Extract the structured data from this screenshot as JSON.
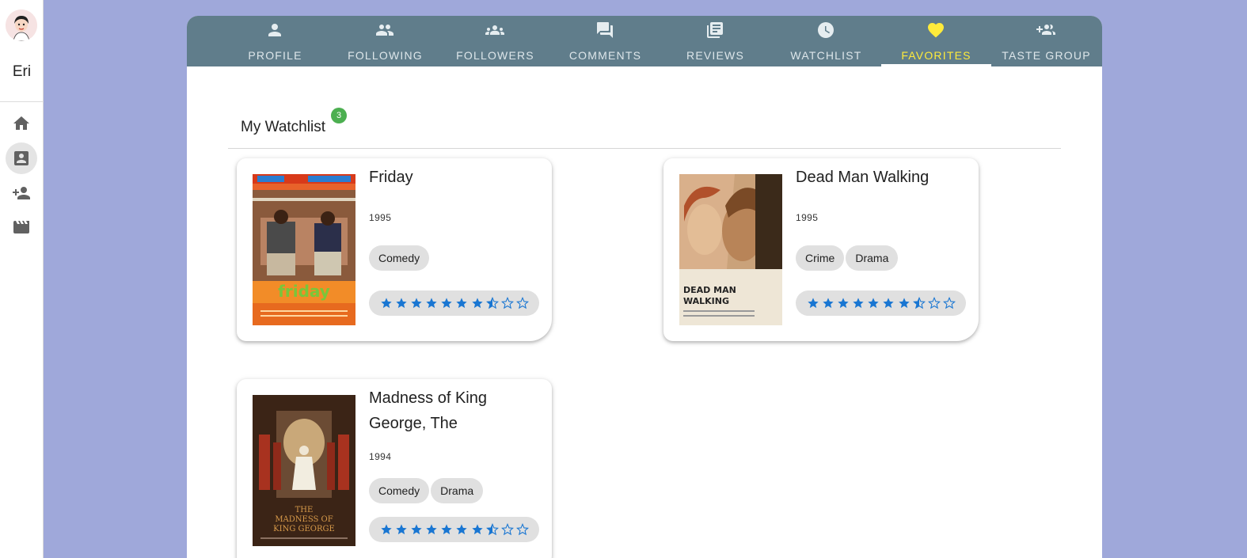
{
  "sidebar": {
    "user_name": "Eri",
    "items": [
      {
        "icon": "home-icon"
      },
      {
        "icon": "profile-card-icon",
        "active": true
      },
      {
        "icon": "person-add-icon"
      },
      {
        "icon": "movie-icon"
      }
    ]
  },
  "tabs": [
    {
      "label": "PROFILE",
      "icon": "person-icon"
    },
    {
      "label": "FOLLOWING",
      "icon": "people-icon"
    },
    {
      "label": "FOLLOWERS",
      "icon": "groups-icon"
    },
    {
      "label": "COMMENTS",
      "icon": "comments-icon"
    },
    {
      "label": "REVIEWS",
      "icon": "reviews-icon"
    },
    {
      "label": "WATCHLIST",
      "icon": "clock-icon"
    },
    {
      "label": "FAVORITES",
      "icon": "heart-icon",
      "active": true
    },
    {
      "label": "TASTE GROUP",
      "icon": "group-add-icon"
    }
  ],
  "section": {
    "title": "My Watchlist",
    "count": "3"
  },
  "movies": [
    {
      "title": "Friday",
      "year": "1995",
      "genres": [
        "Comedy"
      ],
      "rating": 7.5,
      "max_rating": 10
    },
    {
      "title": "Dead Man Walking",
      "year": "1995",
      "genres": [
        "Crime",
        "Drama"
      ],
      "rating": 7.5,
      "max_rating": 10
    },
    {
      "title": "Madness of King George, The",
      "year": "1994",
      "genres": [
        "Comedy",
        "Drama"
      ],
      "rating": 7.5,
      "max_rating": 10
    }
  ],
  "colors": {
    "background": "#9fa8da",
    "tabbar": "#607d8b",
    "active_tab": "#ffeb3b",
    "star": "#1976d2",
    "badge": "#4caf50"
  }
}
